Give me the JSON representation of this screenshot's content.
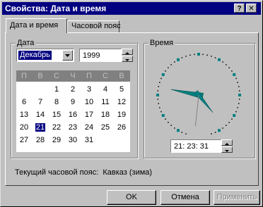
{
  "window": {
    "title": "Свойства: Дата и время",
    "help_label": "?",
    "close_label": "✕"
  },
  "tabs": [
    {
      "label": "Дата и время"
    },
    {
      "label": "Часовой пояс"
    }
  ],
  "date_group": {
    "label": "Дата",
    "month": "Декабрь",
    "year": "1999",
    "weekdays": [
      "П",
      "В",
      "С",
      "Ч",
      "П",
      "С",
      "В"
    ],
    "weeks": [
      [
        "",
        "",
        "1",
        "2",
        "3",
        "4",
        "5"
      ],
      [
        "6",
        "7",
        "8",
        "9",
        "10",
        "11",
        "12"
      ],
      [
        "13",
        "14",
        "15",
        "16",
        "17",
        "18",
        "19"
      ],
      [
        "20",
        "21",
        "22",
        "23",
        "24",
        "25",
        "26"
      ],
      [
        "27",
        "28",
        "29",
        "30",
        "31",
        "",
        ""
      ]
    ],
    "selected_day": "21"
  },
  "time_group": {
    "label": "Время",
    "time": "21: 23: 31",
    "clock": {
      "hour": 21,
      "minute": 23,
      "second": 31
    }
  },
  "timezone_text": "Текущий часовой пояс:  Кавказ (зима)",
  "buttons": {
    "ok": "OK",
    "cancel": "Отмена",
    "apply": "Применить"
  },
  "colors": {
    "titlebar": "#000080",
    "face": "#c0c0c0",
    "clock_hands": "#008080"
  }
}
